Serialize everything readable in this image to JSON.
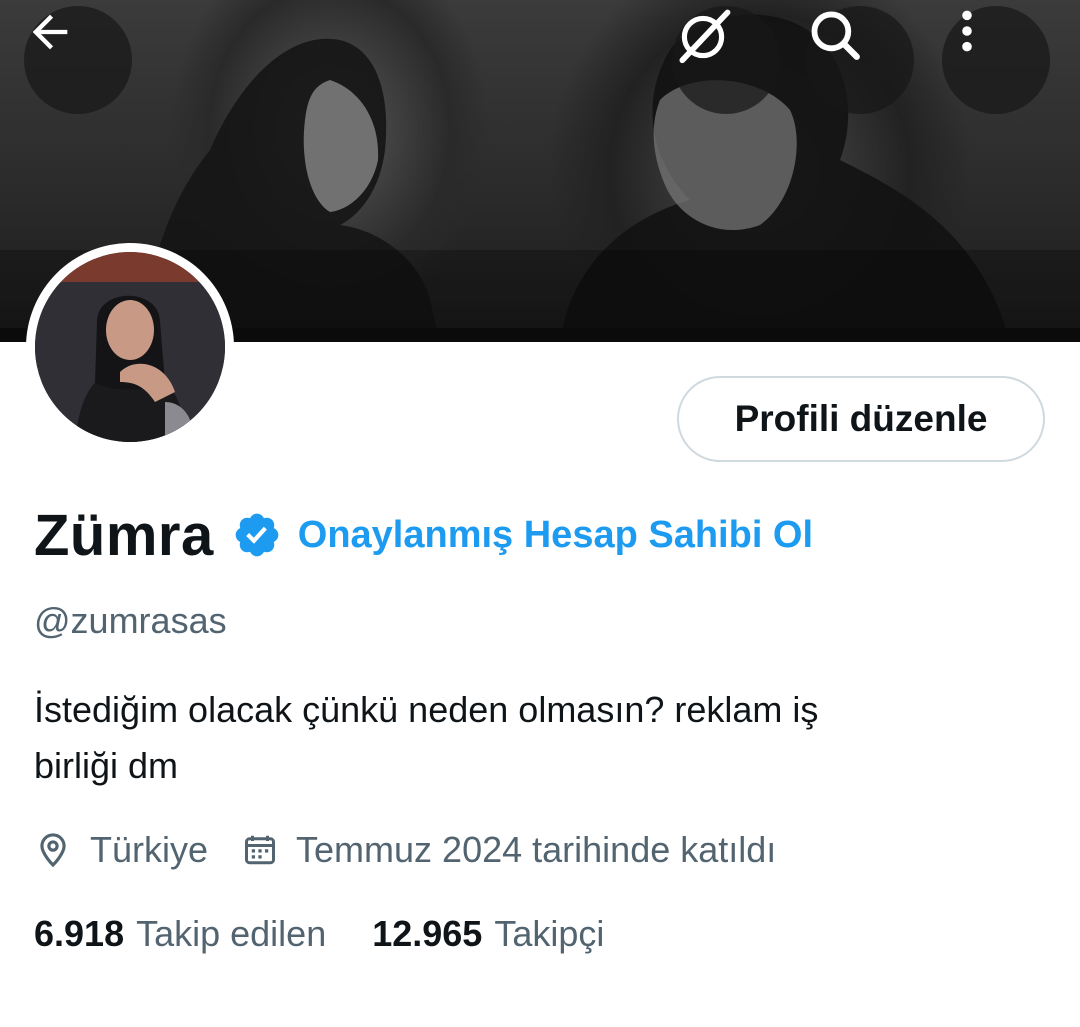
{
  "header": {
    "back_icon": "arrow-left-icon",
    "grok_icon": "grok-slash-icon",
    "search_icon": "search-icon",
    "more_icon": "more-vertical-icon"
  },
  "profile": {
    "edit_button_label": "Profili düzenle",
    "display_name": "Zümra",
    "verified_badge_icon": "verified-badge-icon",
    "verified_link_label": "Onaylanmış Hesap Sahibi Ol",
    "handle": "@zumrasas",
    "bio_line1": "İstediğim olacak çünkü neden olmasın?  reklam iş",
    "bio_line2": "birliği dm",
    "location": "Türkiye",
    "location_icon": "location-pin-icon",
    "joined": "Temmuz 2024 tarihinde katıldı",
    "joined_icon": "calendar-icon"
  },
  "stats": {
    "following_count": "6.918",
    "following_label": "Takip edilen",
    "followers_count": "12.965",
    "followers_label": "Takipçi"
  },
  "colors": {
    "accent": "#1d9bf0",
    "text_primary": "#0f1419",
    "text_secondary": "#536471",
    "border": "#cfd9de"
  }
}
